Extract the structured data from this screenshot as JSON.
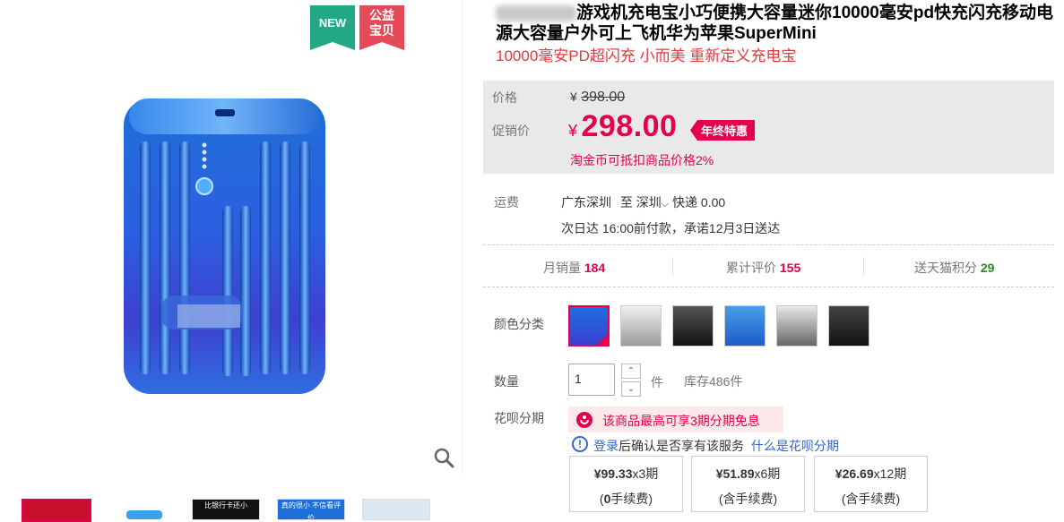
{
  "gallery": {
    "badge_new": "NEW",
    "badge_charity_line1": "公益",
    "badge_charity_line2": "宝贝",
    "thumb_texts": [
      "",
      "",
      "比银行卡还小",
      "真的很小 不信看评价",
      ""
    ]
  },
  "product": {
    "title_visible": "游戏机充电宝小巧便携大容量迷你10000毫安pd快充闪充移动电源大容量户外可上飞机华为苹果SuperMini",
    "subtitle": "10000毫安PD超闪充 小而美 重新定义充电宝"
  },
  "price": {
    "label_price": "价格",
    "old_price": "398.00",
    "label_promo": "促销价",
    "currency": "¥",
    "promo_price": "298.00",
    "promo_tag": "年终特惠",
    "coin_note": "淘金币可抵扣商品价格2%"
  },
  "shipping": {
    "label": "运费",
    "from": "广东深圳",
    "to_word": "至",
    "to": "深圳",
    "method": "快递 0.00",
    "delivery_note": "次日达 16:00前付款，承诺12月3日送达"
  },
  "stats": [
    {
      "label": "月销量",
      "value": "184"
    },
    {
      "label": "累计评价",
      "value": "155"
    },
    {
      "label": "送天猫积分",
      "value": "29"
    }
  ],
  "options": {
    "color_label": "颜色分类",
    "quantity_label": "数量",
    "quantity_value": "1",
    "unit": "件",
    "stock": "库存486件",
    "installment_label": "花呗分期"
  },
  "huabei": {
    "tip": "该商品最高可享3期分期免息",
    "login_link": "登录",
    "login_text": "后确认是否享有该服务",
    "what_link": "什么是花呗分期",
    "plans": [
      {
        "amount": "¥99.33",
        "periods": "x3期",
        "fee_bold": "0",
        "fee_text": "手续费"
      },
      {
        "amount": "¥51.89",
        "periods": "x6期",
        "fee_bold": "",
        "fee_text": "含手续费"
      },
      {
        "amount": "¥26.69",
        "periods": "x12期",
        "fee_bold": "",
        "fee_text": "含手续费"
      }
    ]
  },
  "colors": {
    "price_red": "#e4004f",
    "link_blue": "#3366cc",
    "badge_green": "#23a886",
    "badge_red": "#e44a57"
  }
}
